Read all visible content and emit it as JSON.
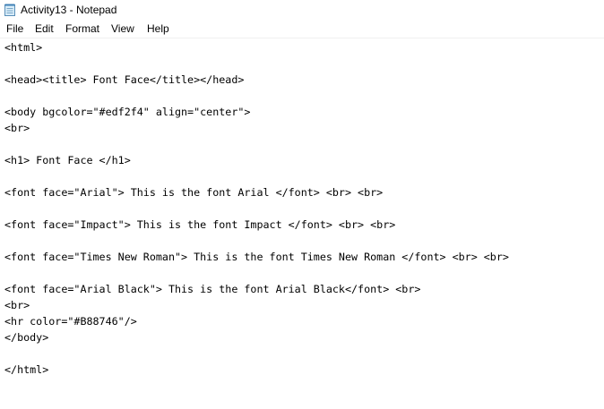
{
  "window": {
    "title": "Activity13 - Notepad",
    "icon": "notepad-icon"
  },
  "menu": {
    "file": "File",
    "edit": "Edit",
    "format": "Format",
    "view": "View",
    "help": "Help"
  },
  "editor": {
    "lines": [
      "<html>",
      "",
      "<head><title> Font Face</title></head>",
      "",
      "<body bgcolor=\"#edf2f4\" align=\"center\">",
      "<br>",
      "",
      "<h1> Font Face </h1>",
      "",
      "<font face=\"Arial\"> This is the font Arial </font> <br> <br>",
      "",
      "<font face=\"Impact\"> This is the font Impact </font> <br> <br>",
      "",
      "<font face=\"Times New Roman\"> This is the font Times New Roman </font> <br> <br>",
      "",
      "<font face=\"Arial Black\"> This is the font Arial Black</font> <br>",
      "<br>",
      "<hr color=\"#B88746\"/>",
      "</body>",
      "",
      "</html>"
    ]
  }
}
